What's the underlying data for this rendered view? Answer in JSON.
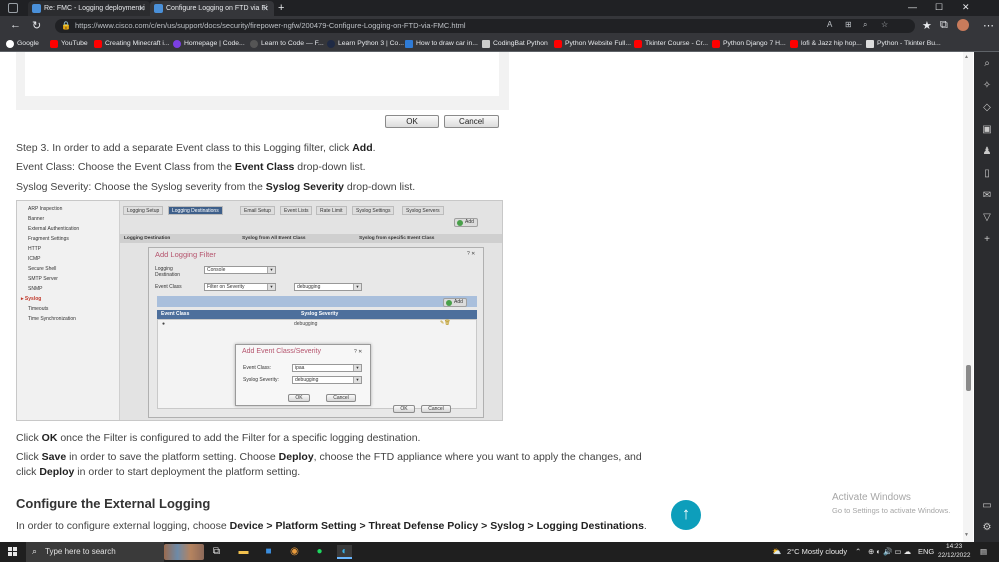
{
  "browser": {
    "tabs": [
      {
        "title": "Re: FMC - Logging deployment i",
        "favicon_color": "#4a90d9"
      },
      {
        "title": "Configure Logging on FTD via Fi",
        "favicon_color": "#4a90d9"
      }
    ],
    "url": "https://www.cisco.com/c/en/us/support/docs/security/firepower-ngfw/200479-Configure-Logging-on-FTD-via-FMC.html",
    "bookmarks": [
      {
        "label": "Google",
        "color": "#ffffff"
      },
      {
        "label": "YouTube",
        "color": "#ff0000"
      },
      {
        "label": "Creating Minecraft i...",
        "color": "#ff0000"
      },
      {
        "label": "Homepage | Code...",
        "color": "#7b3fe4"
      },
      {
        "label": "Learn to Code — F...",
        "color": "#333333"
      },
      {
        "label": "Learn Python 3 | Co...",
        "color": "#1f2a44"
      },
      {
        "label": "How to draw car in...",
        "color": "#2f7bd6"
      },
      {
        "label": "CodingBat Python",
        "color": "#cccccc"
      },
      {
        "label": "Python Website Full...",
        "color": "#ff0000"
      },
      {
        "label": "Tkinter Course - Cr...",
        "color": "#ff0000"
      },
      {
        "label": "Python Django 7 H...",
        "color": "#ff0000"
      },
      {
        "label": "lofi & Jazz hip hop...",
        "color": "#ff0000"
      },
      {
        "label": "Python - Tkinter Bu...",
        "color": "#dddddd"
      }
    ]
  },
  "content": {
    "top_buttons": {
      "ok": "OK",
      "cancel": "Cancel"
    },
    "step3": {
      "pre": "Step 3. In order to add a separate Event class to this Logging filter, click ",
      "bold": "Add",
      "post": "."
    },
    "event_class": {
      "pre": "Event Class: Choose the Event Class from the ",
      "bold": "Event Class",
      "post": " drop-down list."
    },
    "syslog_severity": {
      "pre": "Syslog Severity: Choose the Syslog severity from the ",
      "bold": "Syslog Severity",
      "post": " drop-down list."
    },
    "click_ok": {
      "pre": "Click ",
      "bold": "OK",
      "post": " once the Filter is configured to add the Filter for a specific logging destination."
    },
    "click_save": {
      "a": "Click ",
      "b1": "Save",
      "c": " in order to save the platform setting. Choose ",
      "b2": "Deploy",
      "d": ", choose the FTD appliance where you want to apply the changes, and",
      "e": "click ",
      "b3": "Deploy",
      "f": " in order to start deployment the platform setting."
    },
    "heading": "Configure the External Logging",
    "external": {
      "pre": "In order to configure external logging, choose ",
      "bold": "Device > Platform Setting > Threat Defense Policy > Syslog > Logging Destinations",
      "post": "."
    }
  },
  "screenshot": {
    "nav_items": [
      "ARP Inspection",
      "Banner",
      "External Authentication",
      "Fragment Settings",
      "HTTP",
      "ICMP",
      "Secure Shell",
      "SMTP Server",
      "SNMP",
      "Syslog",
      "Timeouts",
      "Time Synchronization"
    ],
    "active_nav": "Syslog",
    "tabs": [
      "Logging Setup",
      "Logging Destinations",
      "Email Setup",
      "Event Lists",
      "Rate Limit",
      "Syslog Settings",
      "Syslog Servers"
    ],
    "selected_tab": "Logging Destinations",
    "add_label": "Add",
    "table_headers": [
      "Logging Destination",
      "Syslog from All Event Class",
      "Syslog from specific Event Class"
    ],
    "filter_dialog": {
      "title": "Add Logging Filter",
      "close": "? ✕",
      "logging_destination_label": "Logging\nDestination",
      "logging_destination_value": "Console",
      "event_class_label": "Event Class",
      "event_class_value": "Filter on Severity",
      "severity_value": "debugging",
      "add_label": "Add",
      "grid_headers": [
        "Event Class",
        "Syslog Severity"
      ],
      "grid_row_value": "debugging",
      "ok": "OK",
      "cancel": "Cancel"
    },
    "severity_dialog": {
      "title": "Add Event Class/Severity",
      "close": "? ✕",
      "event_class_label": "Event Class:",
      "event_class_value": "ipaa",
      "severity_label": "Syslog Severity:",
      "severity_value": "debugging",
      "ok": "OK",
      "cancel": "Cancel"
    }
  },
  "watermark": {
    "line1": "Activate Windows",
    "line2": "Go to Settings to activate Windows."
  },
  "taskbar": {
    "search_placeholder": "Type here to search",
    "weather": "2°C  Mostly cloudy",
    "lang": "ENG",
    "time": "14:23",
    "date": "22/12/2022"
  }
}
